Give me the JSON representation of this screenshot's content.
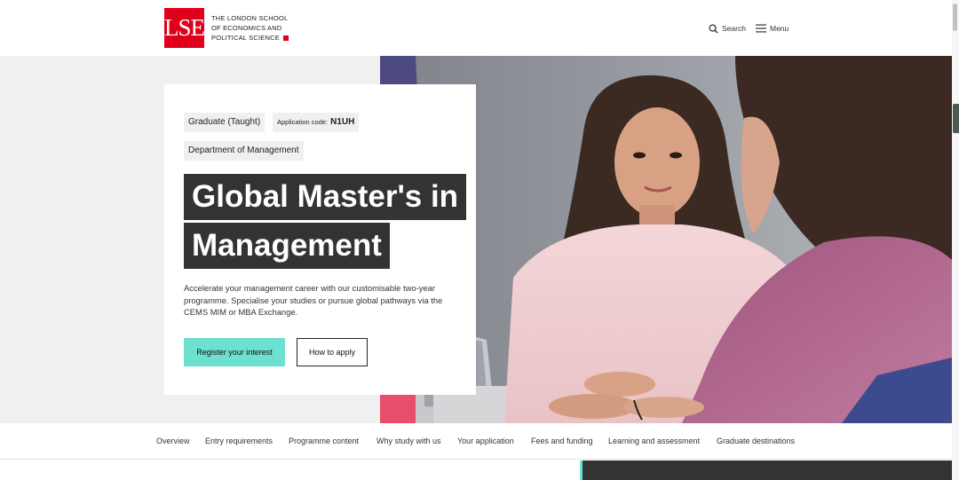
{
  "header": {
    "logo_mark": "LSE",
    "logo_lines": [
      "THE LONDON SCHOOL",
      "OF ECONOMICS AND",
      "POLITICAL SCIENCE"
    ],
    "search_label": "Search",
    "menu_label": "Menu"
  },
  "programme": {
    "level_tag": "Graduate (Taught)",
    "application_code_label": "Application code:",
    "application_code": "N1UH",
    "department": "Department of Management",
    "title_line_1": "Global Master's in",
    "title_line_2": "Management",
    "description": "Accelerate your management career with our customisable two-year programme. Specialise your studies or pursue global pathways via the CEMS MIM or MBA Exchange.",
    "register_label": "Register your interest",
    "apply_label": "How to apply"
  },
  "section_nav": [
    "Overview",
    "Entry requirements",
    "Programme content",
    "Why study with us",
    "Your application",
    "Fees and funding",
    "Learning and assessment",
    "Graduate destinations"
  ],
  "colors": {
    "brand_red": "#e0001b",
    "accent_teal": "#6ee0cf",
    "title_bg": "#333333"
  },
  "icons": {
    "search": "search-icon",
    "menu": "hamburger-menu-icon"
  }
}
